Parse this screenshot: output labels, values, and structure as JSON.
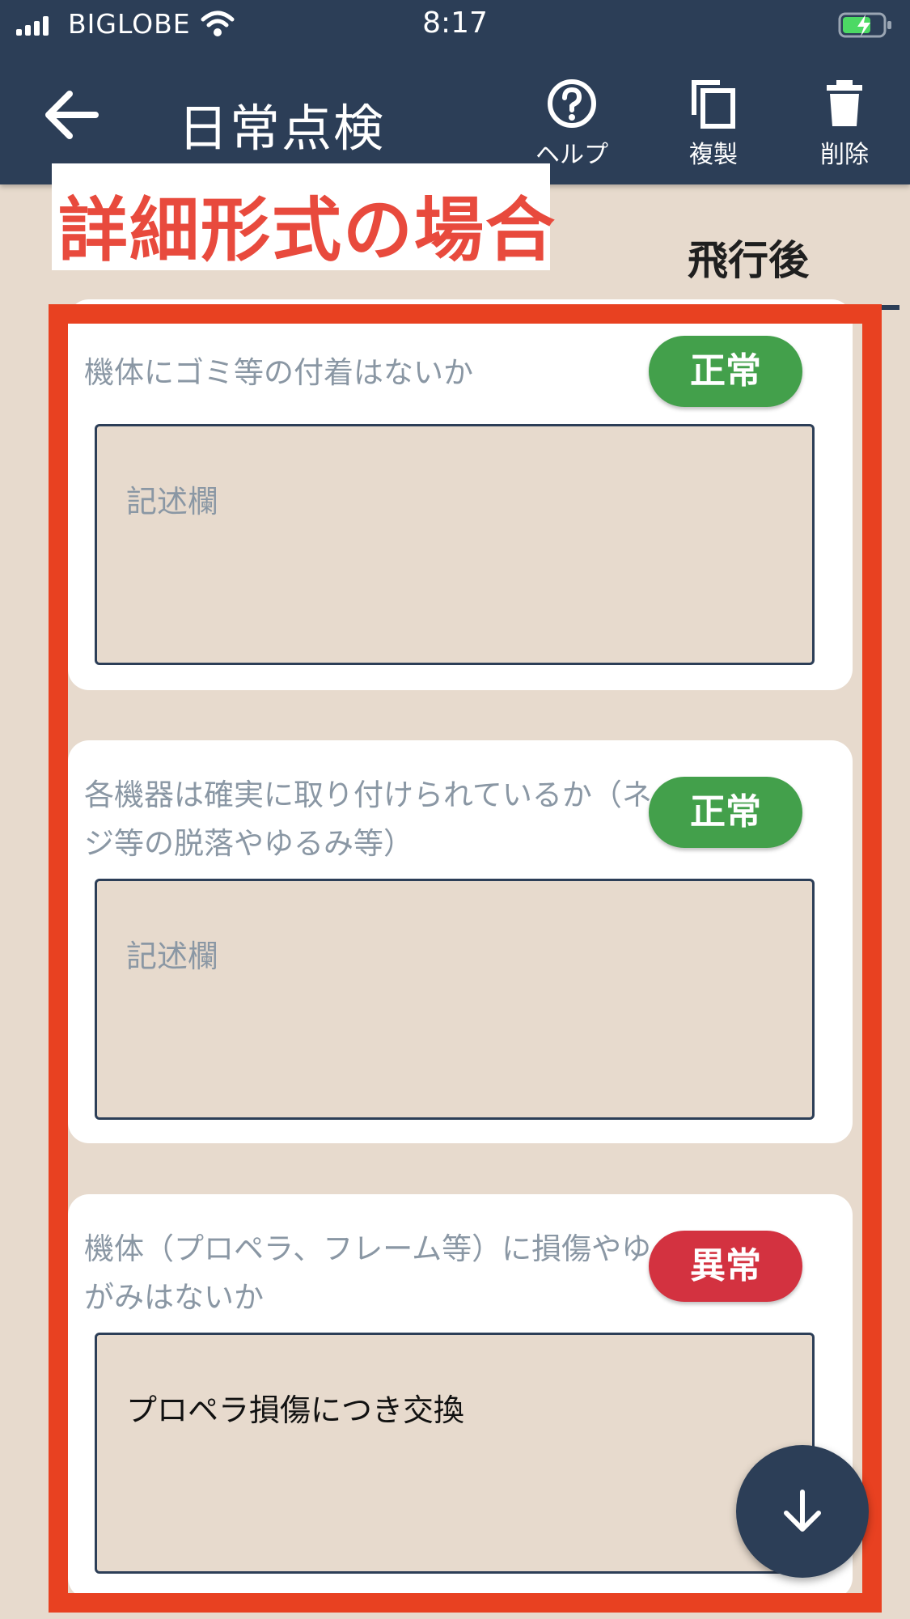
{
  "status_bar": {
    "carrier": "BIGLOBE",
    "time": "8:17"
  },
  "header": {
    "title": "日常点検",
    "help_label": "ヘルプ",
    "duplicate_label": "複製",
    "delete_label": "削除"
  },
  "annotation": {
    "label": "詳細形式の場合",
    "color": "#e84a3d"
  },
  "tab": {
    "label": "飛行後"
  },
  "items": [
    {
      "question": "機体にゴミ等の付着はないか",
      "status": "正常",
      "memo_placeholder": "記述欄",
      "memo_value": ""
    },
    {
      "question": "各機器は確実に取り付けられているか（ネジ等の脱落やゆるみ等）",
      "status": "正常",
      "memo_placeholder": "記述欄",
      "memo_value": ""
    },
    {
      "question": "機体（プロペラ、フレーム等）に損傷やゆがみはないか",
      "status": "異常",
      "memo_placeholder": "記述欄",
      "memo_value": "プロペラ損傷につき交換"
    }
  ],
  "colors": {
    "header_bg": "#2c3e57",
    "page_bg": "#e7dacd",
    "ok": "#43a04b",
    "ng": "#d33240",
    "highlight_frame": "#e84121"
  },
  "icons": {
    "back": "arrow-left-icon",
    "help": "question-circle-icon",
    "duplicate": "copy-icon",
    "delete": "trash-icon",
    "scroll": "arrow-down-icon"
  }
}
